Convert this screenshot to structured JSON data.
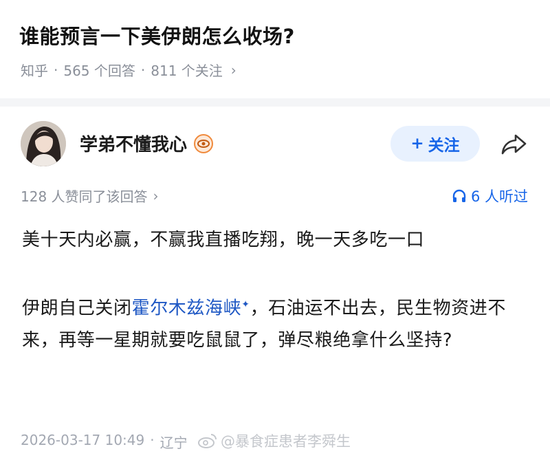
{
  "question": {
    "title": "谁能预言一下美伊朗怎么收场?",
    "source": "知乎",
    "answers": "565 个回答",
    "followers": "811 个关注",
    "sep": "·",
    "chevron": "›"
  },
  "author": {
    "name": "学弟不懂我心",
    "badge_icon": "eye-badge-icon",
    "follow_plus": "+",
    "follow_label": "关注",
    "share_icon": "share-arrow-icon"
  },
  "meta": {
    "votes": "128 人赞同了该回答",
    "chevron": "›",
    "listeners": "6 人听过",
    "headphone_icon": "headphones-icon"
  },
  "content": {
    "p1": "美十天内必赢，不赢我直播吃翔，晚一天多吃一口",
    "p2_before": "伊朗自己关闭",
    "p2_link": "霍尔木兹海峡",
    "p2_sparkle": "✦",
    "p2_after": "，石油运不出去，民生物资进不来，再等一星期就要吃鼠鼠了，弹尽粮绝拿什么坚持?"
  },
  "footer": {
    "datetime": "2026-03-17 10:49",
    "sep": "·",
    "location": "辽宁",
    "watermark": "@暴食症患者李舜生"
  },
  "colors": {
    "accent": "#1765e8",
    "link": "#1f58c4",
    "muted": "#8a8f99",
    "follow_bg": "#e8f1fe"
  }
}
